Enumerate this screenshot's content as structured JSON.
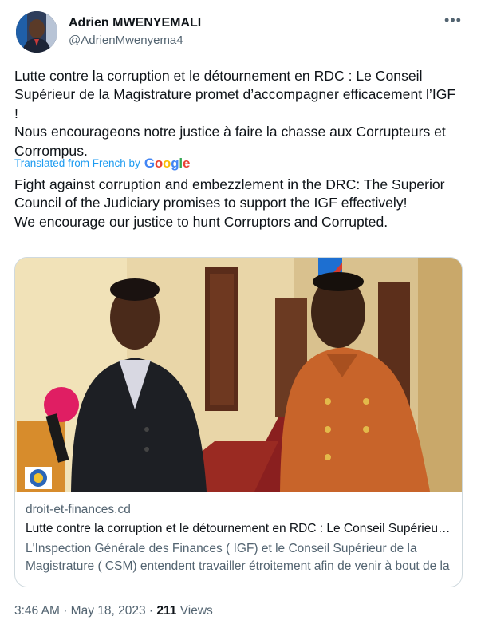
{
  "author": {
    "display_name": "Adrien MWENYEMALI",
    "handle": "@AdrienMwenyema4"
  },
  "more_icon": "more-horizontal-icon",
  "tweet": {
    "text": "Lutte contre la corruption et le détournement en RDC : Le Conseil Supérieur de la Magistrature promet d’accompagner efficacement l’IGF !\nNous encourageons notre justice à faire la chasse aux Corrupteurs et Corrompus.",
    "translated_label": "Translated from French by",
    "translator_logo": "Google",
    "translation": "Fight against corruption and embezzlement in the DRC: The Superior Council of the Judiciary promises to support the IGF effectively!\nWe encourage our justice to hunt Corruptors and Corrupted."
  },
  "card": {
    "domain": "droit-et-finances.cd",
    "title": "Lutte contre la corruption et le détournement en RDC : Le Conseil Supérieur de la Magistrature promet d’accompagner efficacement l’IGF",
    "description": "L'Inspection Générale des Finances ( IGF) et le Conseil Supérieur de la Magistrature ( CSM) entendent travailler étroitement afin de venir à bout de la corruption"
  },
  "meta": {
    "time": "3:46 AM",
    "date": "May 18, 2023",
    "separator": "·",
    "views_count": "211",
    "views_label": "Views"
  },
  "colors": {
    "accent": "#1d9bf0",
    "text": "#0f1419",
    "secondary": "#536471",
    "border": "#cfd9de"
  }
}
